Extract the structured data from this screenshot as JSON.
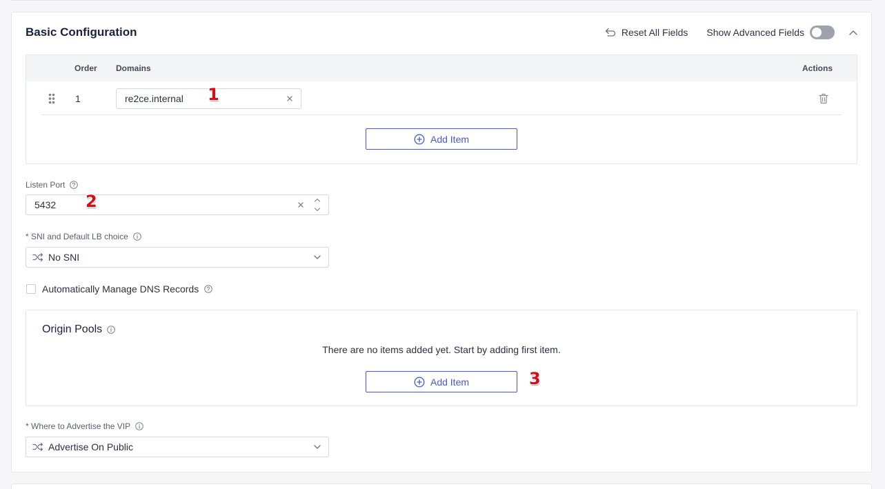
{
  "section": {
    "title": "Basic Configuration",
    "reset_label": "Reset All Fields",
    "advanced_label": "Show Advanced Fields",
    "advanced_enabled": false
  },
  "domains_table": {
    "columns": {
      "order": "Order",
      "domains": "Domains",
      "actions": "Actions"
    },
    "rows": [
      {
        "order": "1",
        "domain": "re2ce.internal"
      }
    ],
    "add_label": "Add Item"
  },
  "listen_port": {
    "label": "Listen Port",
    "value": "5432"
  },
  "sni": {
    "label": "* SNI and Default LB choice",
    "value": "No SNI"
  },
  "dns": {
    "label": "Automatically Manage DNS Records",
    "checked": false
  },
  "origin_pools": {
    "title": "Origin Pools",
    "empty_text": "There are no items added yet. Start by adding first item.",
    "add_label": "Add Item"
  },
  "vip": {
    "label": "* Where to Advertise the VIP",
    "value": "Advertise On Public"
  },
  "annotations": [
    "1",
    "2",
    "3"
  ],
  "icons": {
    "reset": "undo-icon",
    "collapse": "chevron-up-icon",
    "drag": "drag-handle-icon",
    "clear": "close-icon",
    "delete": "trash-icon",
    "add": "plus-circle-icon",
    "help": "help-circle-icon",
    "info": "info-circle-icon",
    "select": "shuffle-icon",
    "dropdown": "chevron-down-icon",
    "stepper": "stepper-icon"
  },
  "colors": {
    "accent": "#4758d1",
    "toggle_off": "#9ea3ab",
    "annotation": "#d30f1c",
    "title": "#1b2240",
    "border": "#e4e6eb"
  }
}
